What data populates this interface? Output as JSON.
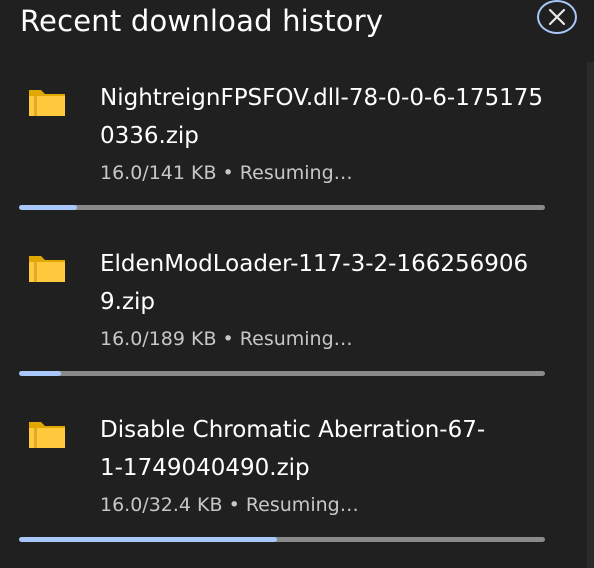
{
  "header": {
    "title": "Recent download history",
    "close_icon": "close-icon"
  },
  "colors": {
    "accent": "#a8c7fa",
    "background": "#202020",
    "track": "#8a8a8a"
  },
  "downloads": [
    {
      "name": "NightreignFPSFOV.dll-78-0-0-6-1751750336.zip",
      "status": "16.0/141 KB • Resuming…",
      "progress": 0.11,
      "icon": "folder-zip-icon"
    },
    {
      "name": "EldenModLoader-117-3-2-1662569069.zip",
      "status": "16.0/189 KB • Resuming…",
      "progress": 0.08,
      "icon": "folder-zip-icon"
    },
    {
      "name": "Disable Chromatic Aberration-67-1-1749040490.zip",
      "status": "16.0/32.4 KB • Resuming…",
      "progress": 0.49,
      "icon": "folder-zip-icon"
    }
  ]
}
